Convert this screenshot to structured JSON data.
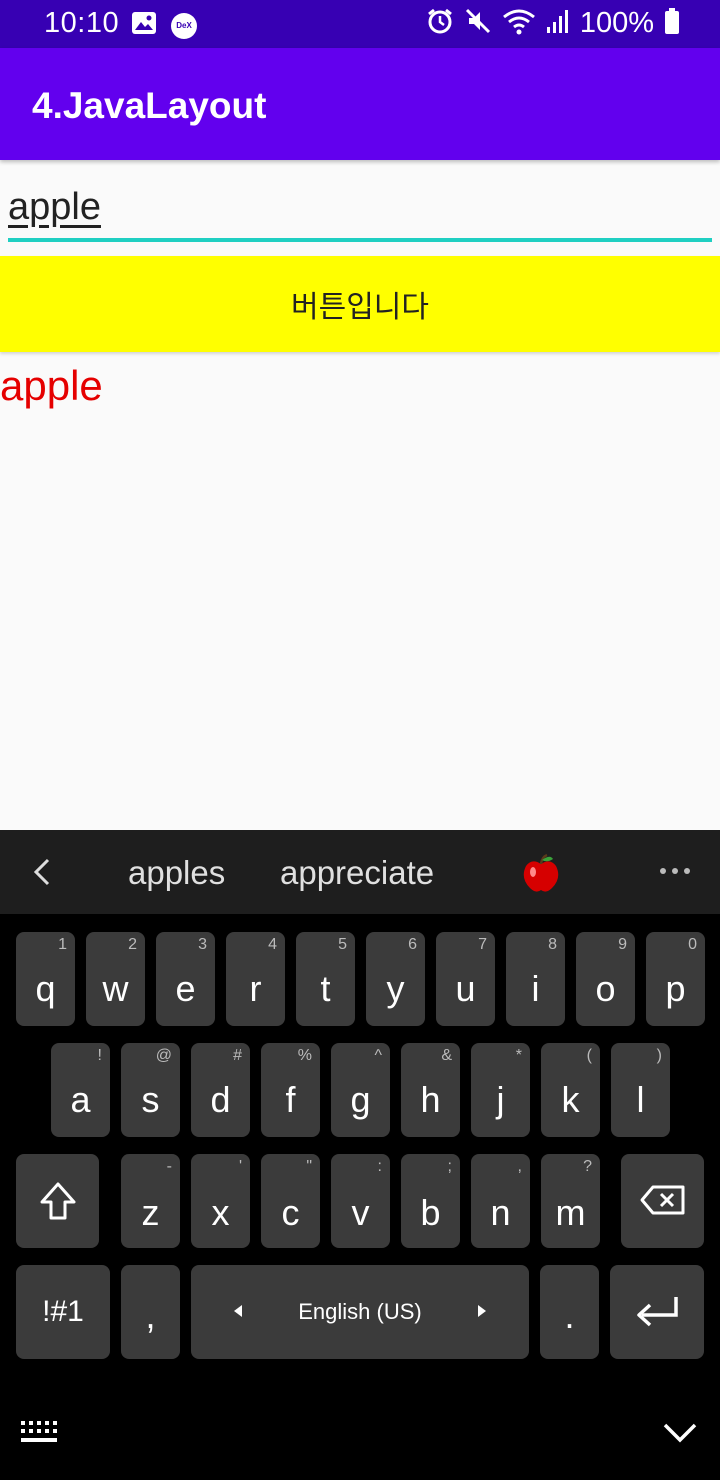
{
  "status_bar": {
    "time": "10:10",
    "battery": "100%",
    "left_icons": [
      "image-icon",
      "dex-icon"
    ],
    "right_icons": [
      "alarm-icon",
      "mute-icon",
      "wifi-icon",
      "signal-icon",
      "battery-icon"
    ],
    "dex_label": "DeX"
  },
  "app_bar": {
    "title": "4.JavaLayout"
  },
  "edit_text": {
    "value": "apple"
  },
  "yellow_button": {
    "label": "버튼입니다"
  },
  "output_text": {
    "value": "apple"
  },
  "colors": {
    "status_bar": "#3700b3",
    "app_bar": "#6200ee",
    "edit_underline": "#1fcfc2",
    "button_bg": "#ffff00",
    "output_text": "#e50000"
  },
  "keyboard": {
    "suggestions": [
      "apples",
      "appreciate"
    ],
    "suggestion_emoji": "apple-icon",
    "row1": [
      {
        "key": "q",
        "sub": "1"
      },
      {
        "key": "w",
        "sub": "2"
      },
      {
        "key": "e",
        "sub": "3"
      },
      {
        "key": "r",
        "sub": "4"
      },
      {
        "key": "t",
        "sub": "5"
      },
      {
        "key": "y",
        "sub": "6"
      },
      {
        "key": "u",
        "sub": "7"
      },
      {
        "key": "i",
        "sub": "8"
      },
      {
        "key": "o",
        "sub": "9"
      },
      {
        "key": "p",
        "sub": "0"
      }
    ],
    "row2": [
      {
        "key": "a",
        "sub": "!"
      },
      {
        "key": "s",
        "sub": "@"
      },
      {
        "key": "d",
        "sub": "#"
      },
      {
        "key": "f",
        "sub": "%"
      },
      {
        "key": "g",
        "sub": "^"
      },
      {
        "key": "h",
        "sub": "&"
      },
      {
        "key": "j",
        "sub": "*"
      },
      {
        "key": "k",
        "sub": "("
      },
      {
        "key": "l",
        "sub": ")"
      }
    ],
    "row3": [
      {
        "key": "z",
        "sub": "-"
      },
      {
        "key": "x",
        "sub": "'"
      },
      {
        "key": "c",
        "sub": "\""
      },
      {
        "key": "v",
        "sub": ":"
      },
      {
        "key": "b",
        "sub": ";"
      },
      {
        "key": "n",
        "sub": ","
      },
      {
        "key": "m",
        "sub": "?"
      }
    ],
    "symbols_label": "!#1",
    "comma_label": ",",
    "space_label": "English (US)",
    "period_label": "."
  }
}
